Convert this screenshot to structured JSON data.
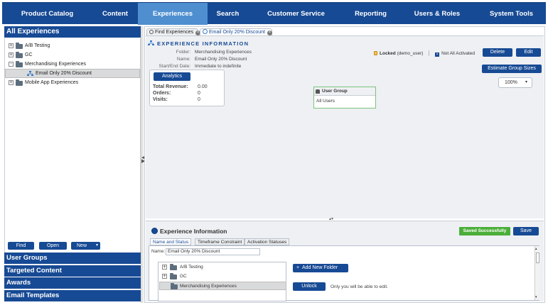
{
  "nav": {
    "items": [
      {
        "label": "Product Catalog",
        "active": false
      },
      {
        "label": "Content",
        "active": false
      },
      {
        "label": "Experiences",
        "active": true
      },
      {
        "label": "Search",
        "active": false
      },
      {
        "label": "Customer Service",
        "active": false
      },
      {
        "label": "Reporting",
        "active": false
      },
      {
        "label": "Users & Roles",
        "active": false
      },
      {
        "label": "System Tools",
        "active": false
      }
    ],
    "bar_color": "#174a94",
    "active_color": "#4f8fd0"
  },
  "left": {
    "header": "All Experiences",
    "tree": [
      {
        "label": "A/B Testing",
        "expander": "+"
      },
      {
        "label": "GC",
        "expander": "+"
      },
      {
        "label": "Merchandising Experiences",
        "expander": "-"
      },
      {
        "label": "Email Only 20% Discount",
        "selected": true,
        "icon": "experience-icon"
      },
      {
        "label": "Mobile App Experiences",
        "expander": "+"
      }
    ],
    "buttons": {
      "find": "Find",
      "open": "Open",
      "new": "New"
    },
    "accordion": [
      "User Groups",
      "Targeted Content",
      "Awards",
      "Email Templates"
    ]
  },
  "tabs": [
    {
      "label": "Find Experiences",
      "icon": "search-icon",
      "active": false
    },
    {
      "label": "Email Only 20% Discount",
      "icon": "experience-icon",
      "active": true
    }
  ],
  "experience": {
    "title": "EXPERIENCE INFORMATION",
    "folder_label": "Folder:",
    "folder_value": "Merchandising Experiences",
    "name_label": "Name:",
    "name_value": "Email Only 20% Discount",
    "dates_label": "Start/End Date:",
    "dates_value": "Immediate to indefinite",
    "lock_text": "Locked",
    "lock_user": "(demo_user)",
    "activation_text": "Not All Activated",
    "delete_label": "Delete",
    "edit_label": "Edit",
    "estimate_label": "Estimate Group Sizes",
    "zoom": "100%",
    "analytics_label": "Analytics",
    "stats": [
      {
        "label": "Total Revenue:",
        "value": "0.00"
      },
      {
        "label": "Orders:",
        "value": "0"
      },
      {
        "label": "Visits:",
        "value": "0"
      }
    ],
    "user_group_title": "User Group",
    "user_group_value": "All Users"
  },
  "bottom": {
    "title": "Experience Information",
    "saved": "Saved Successfully",
    "save_label": "Save",
    "subtabs": [
      "Name and Status",
      "Timeframe Constraint",
      "Activation Statuses"
    ],
    "name_label": "Name:",
    "name_value": "Email Only 20% Discount",
    "folders": [
      {
        "label": "A/B Testing",
        "expander": "+"
      },
      {
        "label": "GC",
        "expander": "+"
      },
      {
        "label": "Merchandising Experiences",
        "selected": true
      }
    ],
    "add_folder_label": "Add New Folder",
    "unlock_label": "Unlock",
    "unlock_note": "Only you will be able to edit.",
    "saved_color": "#4cae3a"
  }
}
